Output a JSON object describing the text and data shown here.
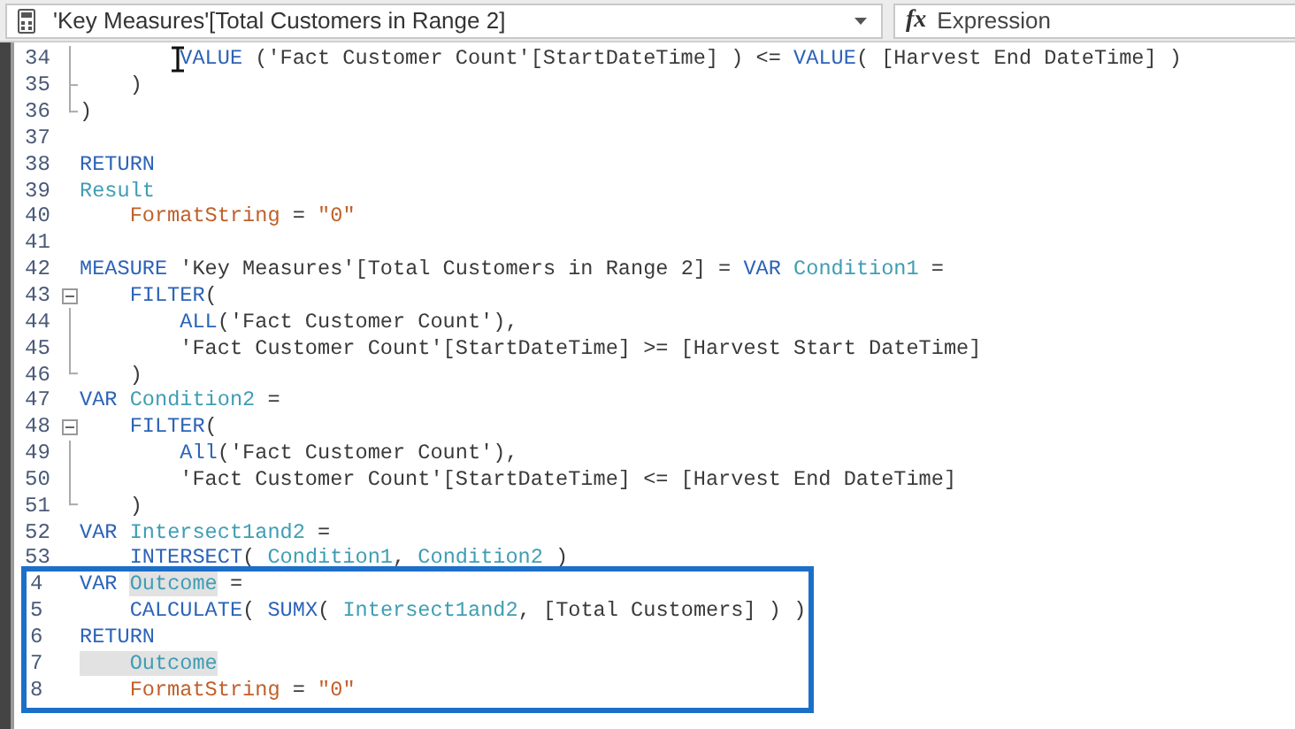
{
  "formula_bar": {
    "measure": "'Key Measures'[Total Customers in Range 2]",
    "fx": "fx",
    "expression_label": "Expression"
  },
  "lines": [
    {
      "number": "34",
      "kind": "guide",
      "cursor": true,
      "tokens": [
        {
          "kind": "keyword",
          "text": "        VALUE"
        },
        {
          "kind": "plain",
          "text": " ('Fact Customer Count'[StartDateTime] ) <= "
        },
        {
          "kind": "keyword",
          "text": "VALUE"
        },
        {
          "kind": "plain",
          "text": "( [Harvest End DateTime] )"
        }
      ]
    },
    {
      "number": "35",
      "kind": "guide-end",
      "tokens": [
        {
          "kind": "plain",
          "text": "    )"
        }
      ]
    },
    {
      "number": "36",
      "kind": "guide-end",
      "tokens": [
        {
          "kind": "plain",
          "text": ")"
        }
      ]
    },
    {
      "number": "37",
      "kind": "plain"
    },
    {
      "number": "38",
      "kind": "plain",
      "tokens": [
        {
          "kind": "keyword",
          "text": "RETURN"
        }
      ]
    },
    {
      "number": "39",
      "kind": "plain",
      "tokens": [
        {
          "kind": "variable",
          "text": "Result"
        }
      ]
    },
    {
      "number": "40",
      "kind": "plain",
      "tokens": [
        {
          "kind": "string",
          "text": "    FormatString"
        },
        {
          "kind": "plain",
          "text": " = "
        },
        {
          "kind": "string",
          "text": "\"0\""
        }
      ]
    },
    {
      "number": "41",
      "kind": "plain"
    },
    {
      "number": "42",
      "kind": "plain",
      "tokens": [
        {
          "kind": "keyword",
          "text": "MEASURE"
        },
        {
          "kind": "plain",
          "text": " 'Key Measures'[Total Customers in Range 2] = "
        },
        {
          "kind": "keyword",
          "text": "VAR "
        },
        {
          "kind": "variable",
          "text": "Condition1"
        },
        {
          "kind": "plain",
          "text": " ="
        }
      ]
    },
    {
      "number": "43",
      "kind": "fold",
      "expanded": true,
      "tokens": [
        {
          "kind": "keyword",
          "text": "    FILTER"
        },
        {
          "kind": "plain",
          "text": "("
        }
      ]
    },
    {
      "number": "44",
      "kind": "guide",
      "tokens": [
        {
          "kind": "keyword",
          "text": "        ALL"
        },
        {
          "kind": "plain",
          "text": "('Fact Customer Count'),"
        }
      ]
    },
    {
      "number": "45",
      "kind": "guide",
      "tokens": [
        {
          "kind": "plain",
          "text": "        'Fact Customer Count'[StartDateTime] >= [Harvest Start DateTime]"
        }
      ]
    },
    {
      "number": "46",
      "kind": "guide-end",
      "tokens": [
        {
          "kind": "plain",
          "text": "    )"
        }
      ]
    },
    {
      "number": "47",
      "kind": "plain",
      "tokens": [
        {
          "kind": "keyword",
          "text": "VAR "
        },
        {
          "kind": "variable",
          "text": "Condition2"
        },
        {
          "kind": "plain",
          "text": " ="
        }
      ]
    },
    {
      "number": "48",
      "kind": "fold",
      "expanded": true,
      "tokens": [
        {
          "kind": "keyword",
          "text": "    FILTER"
        },
        {
          "kind": "plain",
          "text": "("
        }
      ]
    },
    {
      "number": "49",
      "kind": "guide",
      "tokens": [
        {
          "kind": "keyword",
          "text": "        All"
        },
        {
          "kind": "plain",
          "text": "('Fact Customer Count'),"
        }
      ]
    },
    {
      "number": "50",
      "kind": "guide",
      "tokens": [
        {
          "kind": "plain",
          "text": "        'Fact Customer Count'[StartDateTime] <= [Harvest End DateTime]"
        }
      ]
    },
    {
      "number": "51",
      "kind": "guide-end",
      "tokens": [
        {
          "kind": "plain",
          "text": "    )"
        }
      ]
    },
    {
      "number": "52",
      "kind": "plain",
      "tokens": [
        {
          "kind": "keyword",
          "text": "VAR "
        },
        {
          "kind": "variable",
          "text": "Intersect1and2"
        },
        {
          "kind": "plain",
          "text": " ="
        }
      ]
    },
    {
      "number": "53",
      "kind": "plain",
      "tokens": [
        {
          "kind": "keyword",
          "text": "    INTERSECT"
        },
        {
          "kind": "plain",
          "text": "( "
        },
        {
          "kind": "variable",
          "text": "Condition1"
        },
        {
          "kind": "plain",
          "text": ", "
        },
        {
          "kind": "variable",
          "text": "Condition2"
        },
        {
          "kind": "plain",
          "text": " )"
        }
      ]
    },
    {
      "number": "4",
      "kind": "plain",
      "boxed": true,
      "tokens": [
        {
          "kind": "keyword",
          "text": "VAR "
        },
        {
          "kind": "match",
          "text": "Outcome"
        },
        {
          "kind": "plain",
          "text": " ="
        }
      ]
    },
    {
      "number": "5",
      "kind": "plain",
      "boxed": true,
      "tokens": [
        {
          "kind": "keyword",
          "text": "    CALCULATE"
        },
        {
          "kind": "plain",
          "text": "( "
        },
        {
          "kind": "keyword",
          "text": "SUMX"
        },
        {
          "kind": "plain",
          "text": "( "
        },
        {
          "kind": "variable",
          "text": "Intersect1and2"
        },
        {
          "kind": "plain",
          "text": ", [Total Customers] ) )"
        }
      ]
    },
    {
      "number": "6",
      "kind": "plain",
      "boxed": true,
      "tokens": [
        {
          "kind": "keyword",
          "text": "RETURN"
        }
      ]
    },
    {
      "number": "7",
      "kind": "plain",
      "boxed": true,
      "tokens": [
        {
          "kind": "match",
          "text": "    Outcome"
        }
      ]
    },
    {
      "number": "8",
      "kind": "plain",
      "boxed": true,
      "tokens": [
        {
          "kind": "string",
          "text": "    FormatString"
        },
        {
          "kind": "plain",
          "text": " = "
        },
        {
          "kind": "string",
          "text": "\"0\""
        }
      ]
    }
  ]
}
